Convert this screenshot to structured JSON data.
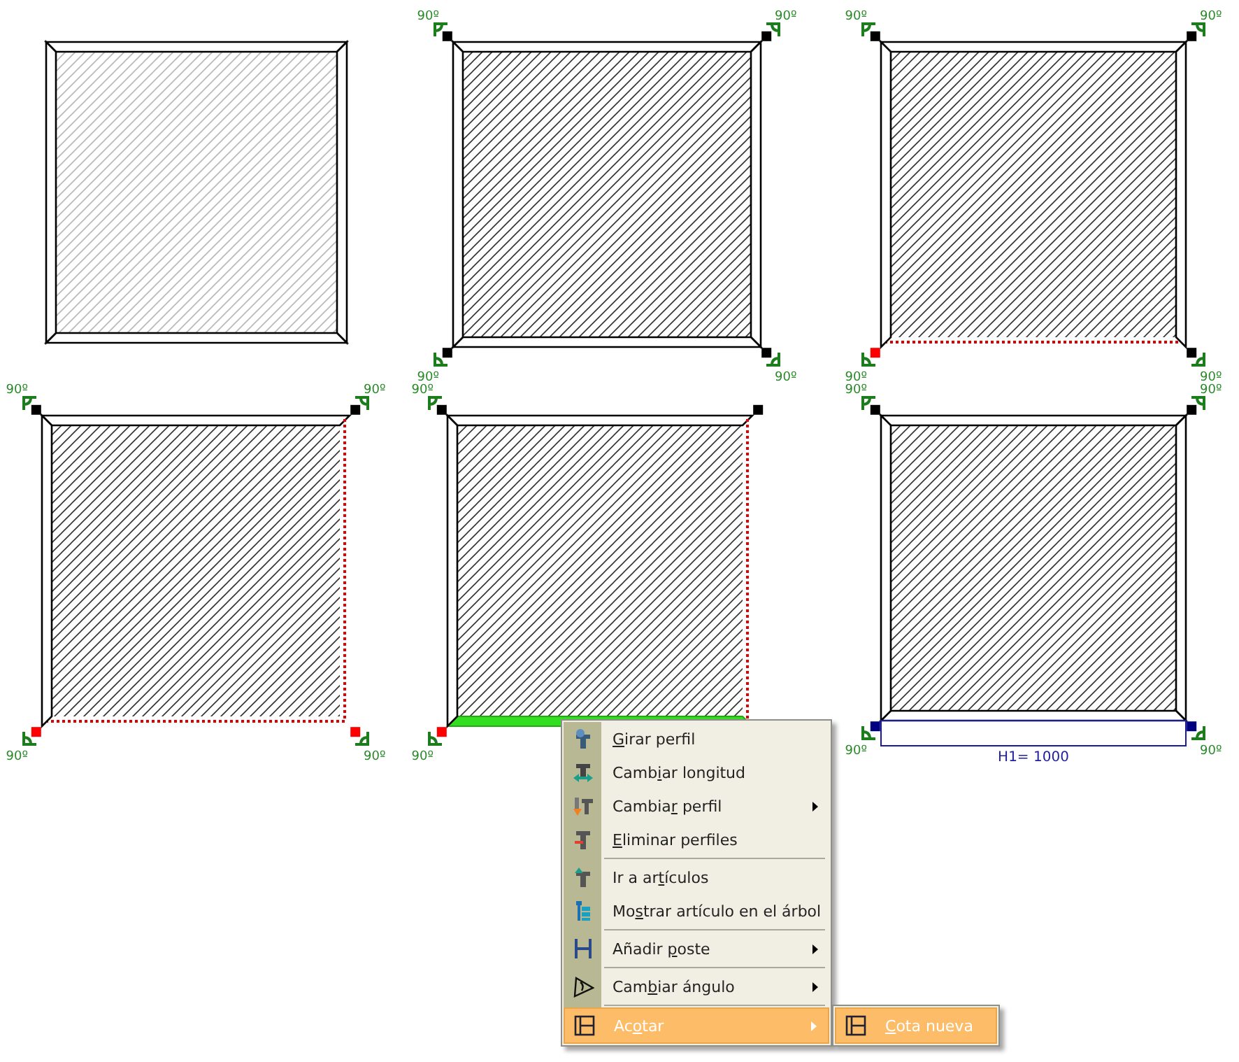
{
  "frames": [
    {
      "greyed": true,
      "edges": [
        {
          "removed": false,
          "selected": false
        },
        {
          "removed": false,
          "selected": false
        },
        {
          "removed": false,
          "selected": false
        },
        {
          "removed": false,
          "selected": false
        }
      ]
    },
    {
      "greyed": false,
      "edges": [
        {
          "removed": false,
          "selected": false
        },
        {
          "removed": false,
          "selected": false
        },
        {
          "removed": false,
          "selected": false
        },
        {
          "removed": false,
          "selected": false
        }
      ],
      "corners": [
        {
          "kind": "top-left",
          "color": "#000000",
          "label": "90º"
        },
        {
          "kind": "top-right",
          "color": "#000000",
          "label": "90º"
        },
        {
          "kind": "bottom-left",
          "color": "#000000",
          "label": "90º"
        },
        {
          "kind": "bottom-right",
          "color": "#000000",
          "label": "90º"
        }
      ]
    },
    {
      "greyed": false,
      "edges": [
        {
          "removed": false,
          "selected": false
        },
        {
          "removed": false,
          "selected": false
        },
        {
          "removed": true,
          "selected": false
        },
        {
          "removed": false,
          "selected": false
        }
      ],
      "corners": [
        {
          "kind": "top-left",
          "color": "#000000",
          "label": "90º"
        },
        {
          "kind": "top-right",
          "color": "#000000",
          "label": "90º"
        },
        {
          "kind": "bottom-left",
          "color": "#ff0000",
          "label": "90º"
        },
        {
          "kind": "bottom-right",
          "color": "#000000",
          "label": "90º"
        }
      ]
    },
    {
      "greyed": false,
      "edges": [
        {
          "removed": false,
          "selected": false
        },
        {
          "removed": true,
          "selected": false
        },
        {
          "removed": true,
          "selected": false
        },
        {
          "removed": false,
          "selected": false
        }
      ],
      "corners": [
        {
          "kind": "top-left",
          "color": "#000000",
          "label": "90º"
        },
        {
          "kind": "top-right",
          "color": "#000000",
          "label": "90º"
        },
        {
          "kind": "bottom-left",
          "color": "#ff0000",
          "label": "90º"
        },
        {
          "kind": "bottom-right",
          "color": "#ff0000",
          "label": "90º"
        }
      ]
    },
    {
      "greyed": false,
      "edges": [
        {
          "removed": false,
          "selected": false
        },
        {
          "removed": true,
          "selected": false
        },
        {
          "removed": false,
          "selected": true
        },
        {
          "removed": false,
          "selected": false
        }
      ],
      "corners": [
        {
          "kind": "top-left",
          "color": "#000000",
          "label": "90º"
        },
        {
          "kind": "top-right",
          "color": "#000000"
        },
        {
          "kind": "bottom-left",
          "color": "#ff0000",
          "label": "90º"
        }
      ]
    },
    {
      "greyed": false,
      "edges": [
        {
          "removed": false,
          "selected": false
        },
        {
          "removed": false,
          "selected": false
        },
        {
          "removed": false,
          "selected": false
        },
        {
          "removed": false,
          "selected": false
        }
      ],
      "corners": [
        {
          "kind": "top-left",
          "color": "#000000",
          "label": "90º"
        },
        {
          "kind": "top-right",
          "color": "#000000",
          "label": "90º"
        },
        {
          "kind": "bottom-left",
          "color": "#000080",
          "label": "90º"
        },
        {
          "kind": "bottom-right",
          "color": "#000080",
          "label": "90º"
        }
      ],
      "dimension": "H1= 1000"
    }
  ],
  "context_menu": {
    "items": [
      {
        "kind": "item",
        "label": {
          "key": "G",
          "after": "irar perfil"
        },
        "submenu": false,
        "selected": false
      },
      {
        "kind": "item",
        "label": {
          "before": "Camb",
          "key": "i",
          "after": "ar longitud"
        },
        "submenu": false,
        "selected": false
      },
      {
        "kind": "item",
        "label": {
          "before": "Cambia",
          "key": "r",
          "after": " perfil"
        },
        "submenu": true,
        "selected": false
      },
      {
        "kind": "item",
        "label": {
          "key": "E",
          "after": "liminar perfiles"
        },
        "submenu": false,
        "selected": false
      },
      {
        "kind": "separator"
      },
      {
        "kind": "item",
        "label": {
          "before": "Ir a ar",
          "key": "t",
          "after": "ículos"
        },
        "submenu": false,
        "selected": false
      },
      {
        "kind": "item",
        "label": {
          "before": "Mo",
          "key": "s",
          "after": "trar artículo en el árbol"
        },
        "submenu": false,
        "selected": false
      },
      {
        "kind": "separator"
      },
      {
        "kind": "item",
        "label": {
          "before": "Añadir ",
          "key": "p",
          "after": "oste"
        },
        "submenu": true,
        "selected": false
      },
      {
        "kind": "separator"
      },
      {
        "kind": "item",
        "label": {
          "before": "Cam",
          "key": "b",
          "after": "iar ángulo"
        },
        "submenu": true,
        "selected": false
      },
      {
        "kind": "separator"
      },
      {
        "kind": "item",
        "label": {
          "before": "Ac",
          "key": "o",
          "after": "tar"
        },
        "submenu": true,
        "selected": true
      }
    ]
  },
  "submenu": {
    "items": [
      {
        "kind": "item",
        "label": {
          "key": "C",
          "after": "ota nueva"
        },
        "submenu": false,
        "selected": true
      }
    ]
  }
}
